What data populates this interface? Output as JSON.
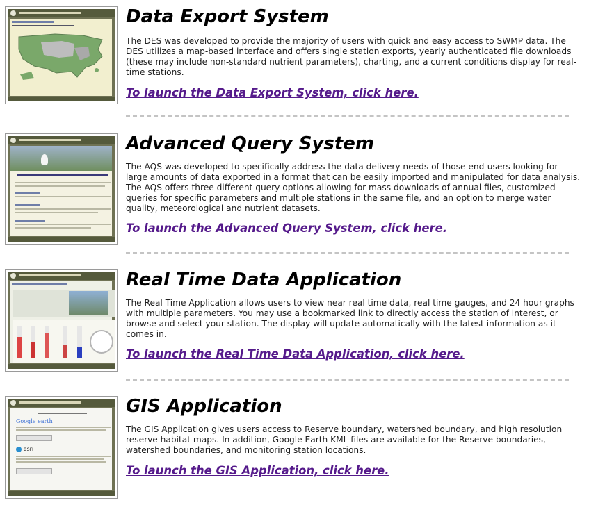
{
  "sections": [
    {
      "title": "Data Export System",
      "description": "The DES was developed to provide the majority of users with quick and easy access to SWMP data. The DES utilizes a map-based interface and offers single station exports, yearly authenticated file downloads (these may include non-standard nutrient parameters), charting, and a current conditions display for real-time stations.",
      "link": "To launch the Data Export System, click here."
    },
    {
      "title": "Advanced Query System",
      "description": "The AQS was developed to specifically address the data delivery needs of those end-users looking for large amounts of data exported in a format that can be easily imported and manipulated for data analysis. The AQS offers three different query options allowing for mass downloads of annual files, customized queries for specific parameters and multiple stations in the same file, and an option to merge water quality, meteorological and nutrient datasets.",
      "link": "To launch the Advanced Query System, click here."
    },
    {
      "title": "Real Time Data Application",
      "description": "The Real Time Application allows users to view near real time data, real time gauges, and 24 hour graphs with multiple parameters. You may use a bookmarked link to directly access the station of interest, or browse and select your station. The display will update automatically with the latest information as it comes in.",
      "link": "To launch the Real Time Data Application, click here."
    },
    {
      "title": "GIS Application",
      "description": "The GIS Application gives users access to Reserve boundary, watershed boundary, and high resolution reserve habitat maps. In addition, Google Earth KML files are available for the Reserve boundaries, watershed boundaries, and monitoring station locations.",
      "link": "To launch the GIS Application, click here."
    }
  ],
  "thumbnails": {
    "des": {
      "header": "National Estuarine Research Reserve System",
      "app_title": "Data Export System",
      "prompt": "Please select a Reserve from the map below:"
    },
    "aqs": {
      "header": "National Estuarine Research Reserve System",
      "app_title": "Advanced Query System",
      "options": [
        "Zip Downloads",
        "Custom Query",
        "Merge Data Query"
      ]
    },
    "rta": {
      "header": "National Estuarine Research Reserve System",
      "app_title": "Real Time Data Application"
    },
    "gis": {
      "header": "National Estuarine Research Reserve System",
      "app_title": "GIS Application",
      "prompt": "Choose your download type:",
      "google_label": "Google earth",
      "google_button": "Choose KML/Google Earth",
      "esri_label": "esri",
      "esri_button": "Choose ESRI/Shapefiles"
    }
  },
  "colors": {
    "link": "#551a8b",
    "thumb_frame": "#6f7254",
    "divider": "#c4c4c4"
  }
}
